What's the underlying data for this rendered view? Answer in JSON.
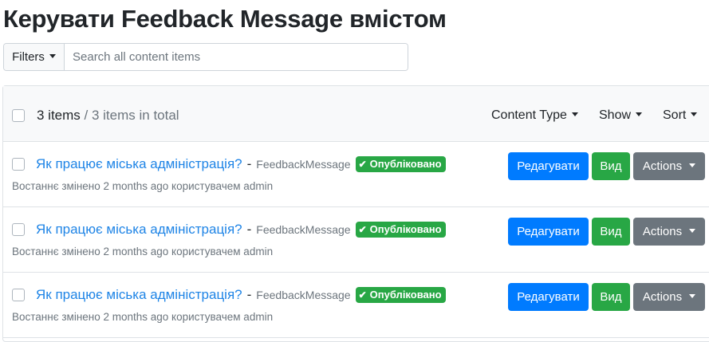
{
  "page": {
    "title": "Керувати Feedback Message вмістом"
  },
  "filterbar": {
    "filters_label": "Filters",
    "search_placeholder": "Search all content items"
  },
  "header": {
    "count": "3 items",
    "total": " / 3 items in total",
    "content_type_label": "Content Type",
    "show_label": "Show",
    "sort_label": "Sort"
  },
  "items": [
    {
      "title": "Як працює міська адміністрація?",
      "separator": "-",
      "content_type": "FeedbackMessage",
      "status": "Опубліковано",
      "meta": "Востаннє змінено 2 months ago користувачем admin",
      "edit_label": "Редагувати",
      "view_label": "Вид",
      "actions_label": "Actions"
    },
    {
      "title": "Як працює міська адміністрація?",
      "separator": "-",
      "content_type": "FeedbackMessage",
      "status": "Опубліковано",
      "meta": "Востаннє змінено 2 months ago користувачем admin",
      "edit_label": "Редагувати",
      "view_label": "Вид",
      "actions_label": "Actions"
    },
    {
      "title": "Як працює міська адміністрація?",
      "separator": "-",
      "content_type": "FeedbackMessage",
      "status": "Опубліковано",
      "meta": "Востаннє змінено 2 months ago користувачем admin",
      "edit_label": "Редагувати",
      "view_label": "Вид",
      "actions_label": "Actions"
    }
  ],
  "colors": {
    "primary": "#007bff",
    "success": "#28a745",
    "secondary": "#6c757d",
    "link": "#1e84e6"
  },
  "icons": {
    "status_check": "check-icon",
    "dropdown": "caret-down-icon"
  }
}
